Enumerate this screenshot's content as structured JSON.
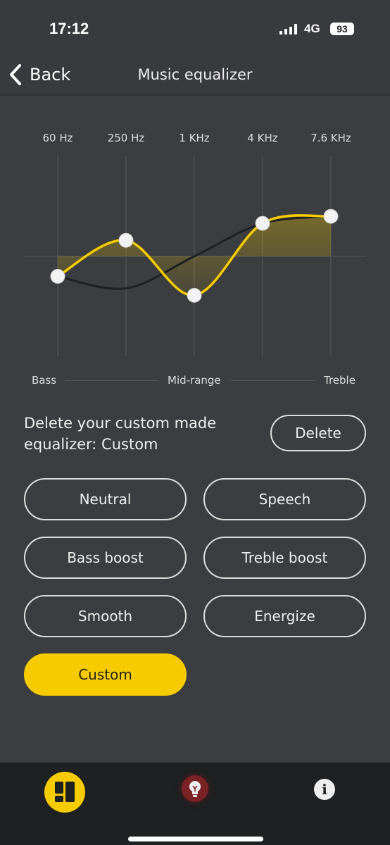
{
  "status": {
    "time": "17:12",
    "network": "4G",
    "battery": "93"
  },
  "nav": {
    "back_label": "Back",
    "title": "Music equalizer"
  },
  "equalizer": {
    "bands": [
      "60 Hz",
      "250 Hz",
      "1 KHz",
      "4 KHz",
      "7.6 KHz"
    ],
    "custom_levels": [
      -0.2,
      0.16,
      -0.39,
      0.33,
      0.4
    ],
    "reference_levels": [
      -0.2,
      -0.32,
      0.0,
      0.33,
      0.4
    ],
    "range_labels": {
      "low": "Bass",
      "mid": "Mid-range",
      "high": "Treble"
    },
    "accent_color": "#f6cb00"
  },
  "delete_section": {
    "text": "Delete your custom made equalizer: Custom",
    "button": "Delete"
  },
  "presets": [
    {
      "label": "Neutral",
      "selected": false
    },
    {
      "label": "Speech",
      "selected": false
    },
    {
      "label": "Bass boost",
      "selected": false
    },
    {
      "label": "Treble boost",
      "selected": false
    },
    {
      "label": "Smooth",
      "selected": false
    },
    {
      "label": "Energize",
      "selected": false
    },
    {
      "label": "Custom",
      "selected": true
    }
  ],
  "tabbar": {
    "items": [
      "dashboard-icon",
      "lightbulb-icon",
      "info-icon"
    ]
  }
}
